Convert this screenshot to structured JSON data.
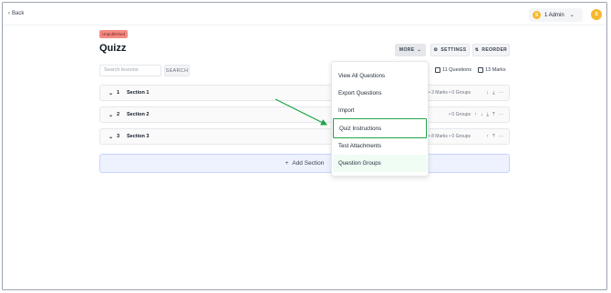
{
  "topbar": {
    "back_label": "Back",
    "account_badge": "S",
    "account_label": "1 Admin",
    "avatar_initial": "S"
  },
  "quiz": {
    "status": "Unpublished",
    "title": "Quizz"
  },
  "toolbar": {
    "more_label": "MORE",
    "settings_label": "SETTINGS",
    "reorder_label": "REORDER"
  },
  "search": {
    "placeholder": "Search lessons",
    "button_label": "SEARCH"
  },
  "stats": {
    "questions": "11 Questions",
    "marks": "13 Marks"
  },
  "sections": [
    {
      "num": "1",
      "name": "Section 1",
      "meta": "• 3 Marks • 0 Groups"
    },
    {
      "num": "2",
      "name": "Section 2",
      "meta": "• 0 Groups"
    },
    {
      "num": "3",
      "name": "Section 3",
      "meta": "• 8 Marks • 0 Groups"
    }
  ],
  "add_section_label": "Add Section",
  "more_menu": {
    "items": [
      "View All Questions",
      "Export Questions",
      "Import",
      "Quiz Instructions",
      "Test Attachments",
      "Question Groups"
    ],
    "highlighted_index": 3
  },
  "colors": {
    "highlight": "#22a44a",
    "status_tag": "#f28b82",
    "avatar": "#f5b82e"
  },
  "icons": [
    "chevron-left-icon",
    "chevron-down-icon",
    "gear-icon",
    "reorder-icon",
    "book-icon",
    "checkbox-icon",
    "arrow-down-icon",
    "arrow-up-icon",
    "more-horizontal-icon",
    "plus-icon"
  ]
}
